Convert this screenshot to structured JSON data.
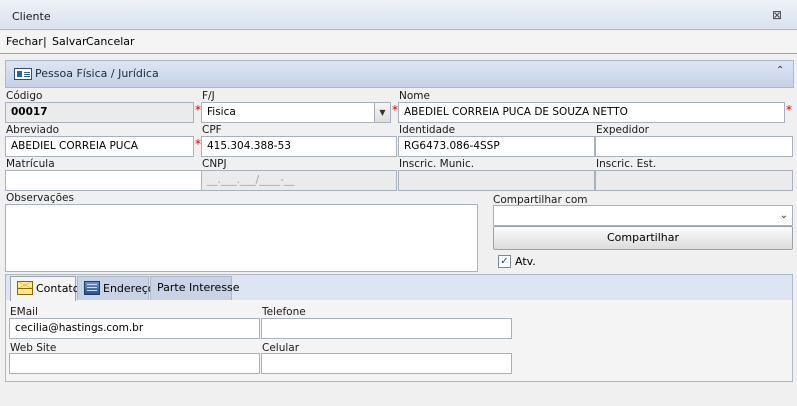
{
  "window": {
    "title": "Cliente",
    "close_icon": "close-x-icon"
  },
  "toolbar": {
    "fechar": "Fechar",
    "separator": "|",
    "salvar": "Salvar",
    "cancelar": "Cancelar"
  },
  "panel": {
    "title": "Pessoa Física / Jurídica",
    "icon": "id-card-icon",
    "collapse_icon": "chevron-up-icon"
  },
  "form": {
    "codigo": {
      "label": "Código",
      "value": "00017"
    },
    "fj": {
      "label": "F/J",
      "value": "Fisica"
    },
    "nome": {
      "label": "Nome",
      "value": "ABEDIEL CORREIA PUCA DE SOUZA NETTO"
    },
    "abreviado": {
      "label": "Abreviado",
      "value": "ABEDIEL CORREIA PUCA"
    },
    "cpf": {
      "label": "CPF",
      "value": "415.304.388-53"
    },
    "identidade": {
      "label": "Identidade",
      "value": "RG6473.086-4SSP"
    },
    "expedidor": {
      "label": "Expedidor",
      "value": ""
    },
    "matricula": {
      "label": "Matrícula",
      "value": ""
    },
    "cnpj": {
      "label": "CNPJ",
      "value": "__.___.___/____-__"
    },
    "insc_munic": {
      "label": "Inscric. Munic.",
      "value": ""
    },
    "insc_est": {
      "label": "Inscric. Est.",
      "value": ""
    },
    "observacoes": {
      "label": "Observações",
      "value": ""
    },
    "compartilhar_com": {
      "label": "Compartilhar com",
      "value": ""
    },
    "compartilhar_button": "Compartilhar",
    "atv": {
      "label": "Atv.",
      "checked": true,
      "mark": "✓"
    }
  },
  "tabs": [
    {
      "label": "Contato",
      "icon": "envelope-icon",
      "active": true
    },
    {
      "label": "Endereço",
      "icon": "building-icon",
      "active": false
    },
    {
      "label": "Parte Interesse",
      "active": false
    }
  ],
  "contato": {
    "email": {
      "label": "EMail",
      "value": "cecilia@hastings.com.br"
    },
    "telefone": {
      "label": "Telefone",
      "value": ""
    },
    "website": {
      "label": "Web Site",
      "value": ""
    },
    "celular": {
      "label": "Celular",
      "value": ""
    }
  },
  "colors": {
    "required": "#d40000",
    "panel_header": "#c5d2e6",
    "title_bar": "#d9e2ee"
  }
}
